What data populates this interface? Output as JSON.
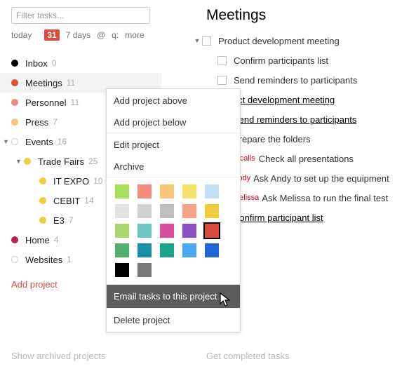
{
  "filter": {
    "placeholder": "Filter tasks..."
  },
  "chips": {
    "today": "today",
    "date": "31",
    "week": "7 days",
    "at": "@",
    "q": "q:",
    "more": "more"
  },
  "projects": {
    "inbox": {
      "name": "Inbox",
      "count": 0,
      "color": "#000000"
    },
    "meet": {
      "name": "Meetings",
      "count": 11,
      "color": "#e24b38"
    },
    "pers": {
      "name": "Personnel",
      "count": 11,
      "color": "#f08a7e"
    },
    "press": {
      "name": "Press",
      "count": 7,
      "color": "#f9c778"
    },
    "events": {
      "name": "Events",
      "count": 16,
      "color": "#ffffff"
    },
    "tf": {
      "name": "Trade Fairs",
      "count": 25,
      "color": "#f2cc3f"
    },
    "it": {
      "name": "IT EXPO",
      "count": 10,
      "color": "#f2cc3f"
    },
    "cebit": {
      "name": "CEBIT",
      "count": 14,
      "color": "#f2cc3f"
    },
    "e3": {
      "name": "E3",
      "count": 7,
      "color": "#f2cc3f"
    },
    "home": {
      "name": "Home",
      "count": 4,
      "color": "#b81e4b"
    },
    "web": {
      "name": "Websites",
      "count": 1,
      "color": "#ffffff"
    }
  },
  "add_project": "Add project",
  "foot_left": "Show archived projects",
  "foot_right": "Get completed tasks",
  "section_title": "Meetings",
  "tasks": {
    "t0": "Product development meeting",
    "t1": "Confirm participants list",
    "t2": "Send reminders to participants",
    "t3": "uct development meeting",
    "t4": "Send reminders to participants",
    "t5": "Prepare the folders",
    "t6": "Check all presentations",
    "t7": "Ask Andy to set up the equipment",
    "t8": "Ask Melissa to run the final test",
    "t9": "Confirm participant list",
    "r6": "recalls",
    "p7": "Andy",
    "p8": "Melissa"
  },
  "ctx": {
    "above": "Add project above",
    "below": "Add project below",
    "edit": "Edit project",
    "archive": "Archive",
    "email": "Email tasks to this project",
    "delete": "Delete project"
  },
  "palette": [
    [
      "#a4e05b",
      "#f58b7f",
      "#f9c778",
      "#f6e36b",
      "#c3dff2"
    ],
    [
      "#e2e2e2",
      "#d0d0d0",
      "#bfbfbf",
      "#f7a28a",
      "#f2cc3f"
    ],
    [
      "#a8d86b",
      "#69c6c3",
      "#d84fa0",
      "#8a4fc4",
      "#db4c3f"
    ],
    [
      "#4fb06c",
      "#1a8fa6",
      "#1aa48a",
      "#4aa9f2",
      "#1f66d6"
    ],
    [
      "#000000",
      "#777777"
    ]
  ]
}
